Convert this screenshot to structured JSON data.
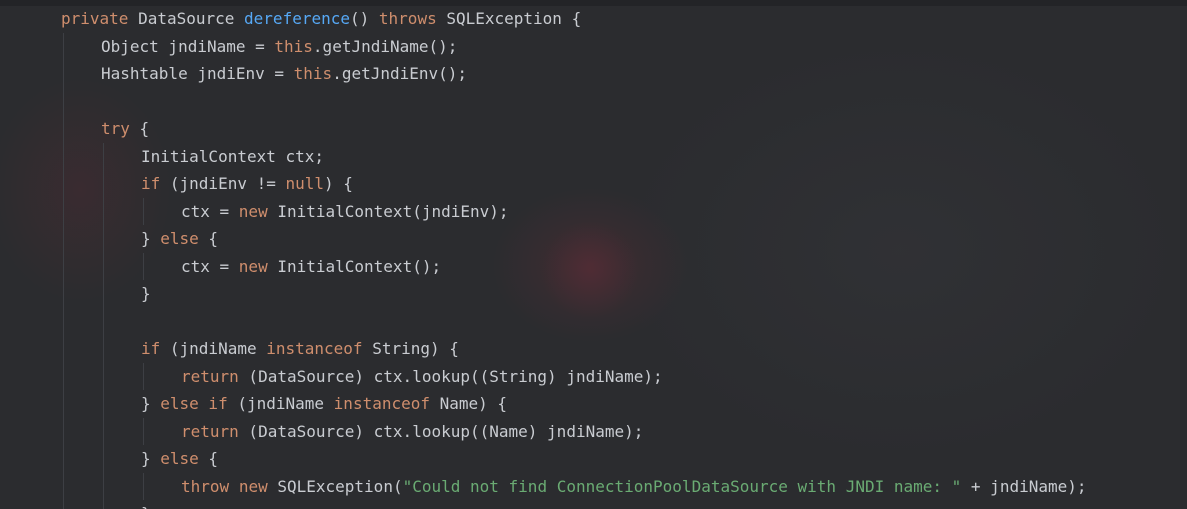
{
  "colors": {
    "background": "#2b2c2f",
    "keyword": "#cf8e6d",
    "function": "#56a8f5",
    "string": "#6aab73",
    "plain": "#c9ccd1"
  },
  "code_lines": [
    {
      "indent": 0,
      "tokens": [
        {
          "t": "private",
          "c": "kw"
        },
        {
          "t": " DataSource ",
          "c": "plain"
        },
        {
          "t": "dereference",
          "c": "fn"
        },
        {
          "t": "() ",
          "c": "plain"
        },
        {
          "t": "throws",
          "c": "kw"
        },
        {
          "t": " SQLException {",
          "c": "plain"
        }
      ]
    },
    {
      "indent": 1,
      "tokens": [
        {
          "t": "Object jndiName = ",
          "c": "plain"
        },
        {
          "t": "this",
          "c": "kw"
        },
        {
          "t": ".getJndiName();",
          "c": "plain"
        }
      ]
    },
    {
      "indent": 1,
      "tokens": [
        {
          "t": "Hashtable jndiEnv = ",
          "c": "plain"
        },
        {
          "t": "this",
          "c": "kw"
        },
        {
          "t": ".getJndiEnv();",
          "c": "plain"
        }
      ]
    },
    {
      "indent": 0,
      "tokens": []
    },
    {
      "indent": 1,
      "tokens": [
        {
          "t": "try",
          "c": "kw"
        },
        {
          "t": " {",
          "c": "plain"
        }
      ]
    },
    {
      "indent": 2,
      "tokens": [
        {
          "t": "InitialContext ctx;",
          "c": "plain"
        }
      ]
    },
    {
      "indent": 2,
      "tokens": [
        {
          "t": "if",
          "c": "kw"
        },
        {
          "t": " (jndiEnv != ",
          "c": "plain"
        },
        {
          "t": "null",
          "c": "kw"
        },
        {
          "t": ") {",
          "c": "plain"
        }
      ]
    },
    {
      "indent": 3,
      "tokens": [
        {
          "t": "ctx = ",
          "c": "plain"
        },
        {
          "t": "new",
          "c": "kw"
        },
        {
          "t": " InitialContext(jndiEnv);",
          "c": "plain"
        }
      ]
    },
    {
      "indent": 2,
      "tokens": [
        {
          "t": "} ",
          "c": "plain"
        },
        {
          "t": "else",
          "c": "kw"
        },
        {
          "t": " {",
          "c": "plain"
        }
      ]
    },
    {
      "indent": 3,
      "tokens": [
        {
          "t": "ctx = ",
          "c": "plain"
        },
        {
          "t": "new",
          "c": "kw"
        },
        {
          "t": " InitialContext();",
          "c": "plain"
        }
      ]
    },
    {
      "indent": 2,
      "tokens": [
        {
          "t": "}",
          "c": "plain"
        }
      ]
    },
    {
      "indent": 0,
      "tokens": []
    },
    {
      "indent": 2,
      "tokens": [
        {
          "t": "if",
          "c": "kw"
        },
        {
          "t": " (jndiName ",
          "c": "plain"
        },
        {
          "t": "instanceof",
          "c": "kw"
        },
        {
          "t": " String) {",
          "c": "plain"
        }
      ]
    },
    {
      "indent": 3,
      "tokens": [
        {
          "t": "return",
          "c": "kw"
        },
        {
          "t": " (DataSource) ctx.lookup((String) jndiName);",
          "c": "plain"
        }
      ]
    },
    {
      "indent": 2,
      "tokens": [
        {
          "t": "} ",
          "c": "plain"
        },
        {
          "t": "else if",
          "c": "kw"
        },
        {
          "t": " (jndiName ",
          "c": "plain"
        },
        {
          "t": "instanceof",
          "c": "kw"
        },
        {
          "t": " Name) {",
          "c": "plain"
        }
      ]
    },
    {
      "indent": 3,
      "tokens": [
        {
          "t": "return",
          "c": "kw"
        },
        {
          "t": " (DataSource) ctx.lookup((Name) jndiName);",
          "c": "plain"
        }
      ]
    },
    {
      "indent": 2,
      "tokens": [
        {
          "t": "} ",
          "c": "plain"
        },
        {
          "t": "else",
          "c": "kw"
        },
        {
          "t": " {",
          "c": "plain"
        }
      ]
    },
    {
      "indent": 3,
      "tokens": [
        {
          "t": "throw",
          "c": "kw"
        },
        {
          "t": " ",
          "c": "plain"
        },
        {
          "t": "new",
          "c": "kw"
        },
        {
          "t": " SQLException(",
          "c": "plain"
        },
        {
          "t": "\"Could not find ConnectionPoolDataSource with JNDI name: \"",
          "c": "str"
        },
        {
          "t": " + jndiName);",
          "c": "plain"
        }
      ]
    },
    {
      "indent": 2,
      "tokens": [
        {
          "t": "}",
          "c": "plain"
        }
      ]
    }
  ]
}
